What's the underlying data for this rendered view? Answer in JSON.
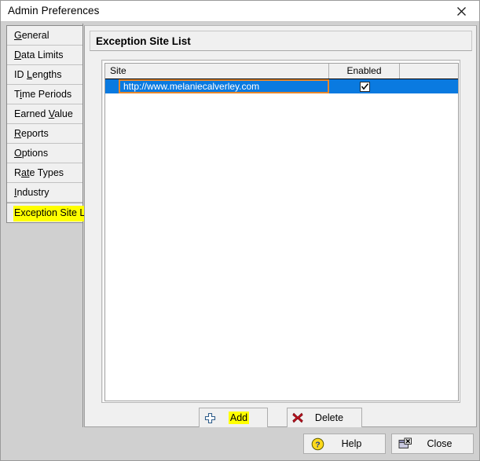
{
  "window": {
    "title": "Admin Preferences",
    "close_icon": "close-x-icon"
  },
  "sidebar": {
    "tabs": [
      {
        "label": "General",
        "mnemonic": "G",
        "selected": false
      },
      {
        "label": "Data Limits",
        "mnemonic": "D",
        "selected": false
      },
      {
        "label": "ID Lengths",
        "mnemonic": "L",
        "selected": false
      },
      {
        "label": "Time Periods",
        "mnemonic": "i",
        "selected": false
      },
      {
        "label": "Earned Value",
        "mnemonic": "V",
        "selected": false
      },
      {
        "label": "Reports",
        "mnemonic": "R",
        "selected": false
      },
      {
        "label": "Options",
        "mnemonic": "O",
        "selected": false
      },
      {
        "label": "Rate Types",
        "mnemonic": "at",
        "selected": false
      },
      {
        "label": "Industry",
        "mnemonic": "I",
        "selected": false
      },
      {
        "label": "Exception Site List",
        "mnemonic": "",
        "selected": true
      }
    ]
  },
  "panel": {
    "header": "Exception Site List",
    "table": {
      "columns": [
        "Site",
        "Enabled",
        ""
      ],
      "rows": [
        {
          "site": "http://www.melaniecalverley.com",
          "enabled": true,
          "selected": true
        }
      ]
    },
    "actions": {
      "add": {
        "label": "Add",
        "icon": "plus-icon",
        "highlighted": true
      },
      "delete": {
        "label": "Delete",
        "icon": "red-x-icon",
        "highlighted": false
      }
    }
  },
  "footer": {
    "help": {
      "label": "Help",
      "icon": "help-question-icon"
    },
    "close": {
      "label": "Close",
      "icon": "close-window-icon"
    }
  },
  "colors": {
    "selection_blue": "#0a7ae0",
    "focus_orange": "#e8872a",
    "highlight_yellow": "#ffff00",
    "panel_gray": "#f0f0f0",
    "window_gray": "#d0d0d0"
  }
}
